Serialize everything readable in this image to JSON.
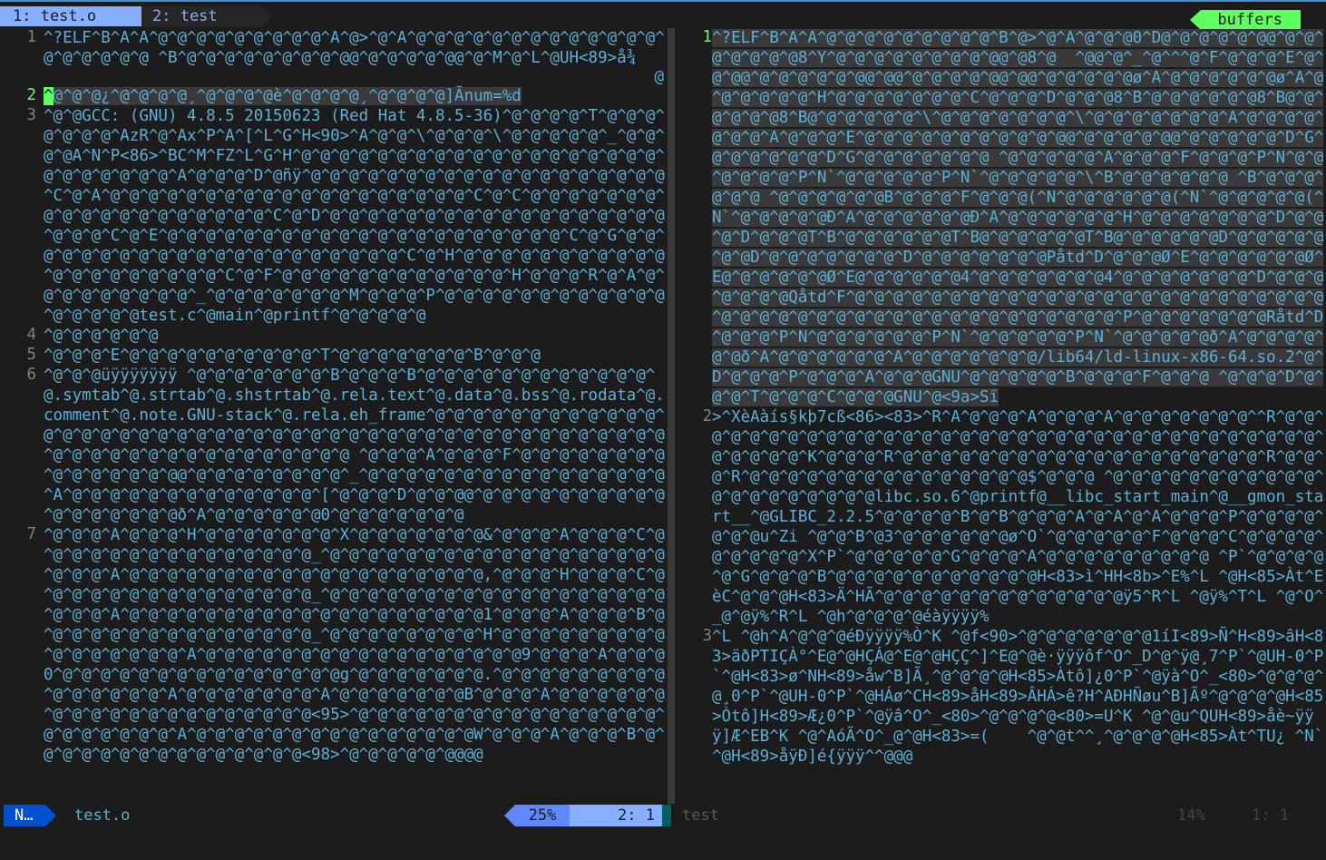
{
  "tabs": [
    {
      "label": "1: test.o"
    },
    {
      "label": "2: test"
    }
  ],
  "buffers_label": "buffers",
  "left_pane": {
    "lines": [
      {
        "num": "1",
        "text": "^?ELF^B^A^A^@^@^@^@^@^@^@^@^@^A^@>^@^A^@^@^@^@^@^@^@^@^@^@^@^@^@^@^@^@^@^@^@ ^B^@^@^@^@^@^@^@^@^@@^@^@^@^@^@@^@^M^@^L^@UH<89>å¾",
        "trail": "@"
      },
      {
        "num": "2",
        "text": "^@^@^@¿^@^@^@^@¸^@^@^@^@è^@^@^@^@¸^@^@^@^@]Ãnum=%d"
      },
      {
        "num": "3",
        "text": "^@^@GCC: (GNU) 4.8.5 20150623 (Red Hat 4.8.5-36)^@^@^@^@^T^@^@^@^@^@^@^@^AzR^@^Ax^P^A^[^L^G^H<90>^A^@^@^\\^@^@^@^\\^@^@^@^@^@^_^@^@^@^@A^N^P<86>^BC^M^FZ^L^G^H^@^@^@^@^@^@^@^@^@^@^@^@^@^@^@^@^@^@^@^@^@^@^@^@^@^@^A^@^@^@^D^@ñÿ^@^@^@^@^@^@^@^@^@^@^@^@^@^@^@^@^@^@^@^C^@^A^@^@^@^@^@^@^@^@^@^@^@^@^@^@^@^@^@^@^@^C^@^C^@^@^@^@^@^@^@^@^@^@^@^@^@^@^@^@^@^@^@^C^@^D^@^@^@^@^@^@^@^@^@^@^@^@^@^@^@^@^@^@^@^@^@^C^@^E^@^@^@^@^@^@^@^@^@^@^@^@^@^@^@^@^@^@^@^@^@^C^@^G^@^@^@^@^@^@^@^@^@^@^@^@^@^@^@^@^@^@^@^@^@^C^@^H^@^@^@^@^@^@^@^@^@^@^@^@^@^@^@^@^@^@^@^@^C^@^F^@^@^@^@^@^@^@^@^@^@^@^@^H^@^@^@^R^@^A^@^@^@^@^@^@^@^@^@^_^@^@^@^@^@^@^@^M^@^@^@^P^@^@^@^@^@^@^@^@^@^@^@^@^@^@^@^@^@test.c^@main^@printf^@^@^@^@^@"
      },
      {
        "num": "4",
        "text": "^@^@^@^@^@^@"
      },
      {
        "num": "5",
        "text": "^@^@^@^E^@^@^@^@^@^@^@^@^@^@^T^@^@^@^@^@^@^@^B^@^@^@"
      },
      {
        "num": "6",
        "text": "^@^@^@üÿÿÿÿÿÿÿ ^@^@^@^@^@^@^@^B^@^@^@^B^@^@^@^@^@^@^@^@^@^@^@^@^@.symtab^@.strtab^@.shstrtab^@.rela.text^@.data^@.bss^@.rodata^@.comment^@.note.GNU-stack^@.rela.eh_frame^@^@^@^@^@^@^@^@^@^@^@^@^@^@^@^@^@^@^@^@^@^@^@^@^@^@^@^@^@^@^@^@^@^@^@^@^@^@^@^@^@^@^@^@^@^@^@^@^@^@^@^@^@^@^@^@^@^@^@^@^@ ^@^@^@^A^@^@^@^F^@^@^@^@^@^@^@^@^@^@^@^@^@^@^@@^@^@^@^@^@^@^@^@^_^@^@^@^@^@^@^@^@^@^@^@^@^@^@^@^@^A^@^@^@^@^@^@^@^@^@^@^@^@^@^[^@^@^@^D^@^@^@@^@^@^@^@^@^@^@^@^@^@^@^@^@^@^@^@^@ð^A^@^@^@^@^@^@0^@^@^@^@^@^@^@"
      },
      {
        "num": "7",
        "text": "^@^@^@^A^@^@^@^H^@^@^@^@^@^@^@^X^@^@^@^@^@^@^@&^@^@^@^A^@^@^@^C^@^@^@^@^@^@^@^@^@^@^@^@^@^@^@_^@^@^@^@^@^@^@^@^@^@^@^@^@^@^@^@^@^@^@^@^@^A^@^@^@^@^@^@^@^@^@^@^@^@^@^@^@^@^@^@^@,^@^@^@^H^@^@^@^C^@^@^@^@^@^@^@^@^@^@^@^@^@^@^@_^@^@^@^@^@^@^@^@^@^@^@^@^@^@^@^@^@^@^@^@^@^A^@^@^@^@^@^@^@^@^@^@^@^@^@^@^@^@^@^@^@1^@^@^@^A^@^@^@^B^@^@^@^@^@^@^@^@^@^@^@^@^@^@^@_^@^@^@^@^@^@^@^@^H^@^@^@^@^@^@^@^@^@^@^@^@^@^@^@^@^A^@^@^@^@^@^@^@^@^@^@^@^@^@^@^@^@^@9^@^@^@^A^@^@^@0^@^@^@^@^@^@^@^@^@^@^@^@^@^@^@g^@^@^@^@^@^@^@.^@^@^@^@^@^@^@^@^@^@^@^@^@^@^@^A^@^@^@^@^@^@^@^A^@^@^@^@^@^@^@B^@^@^@^A^@^@^@^@^@^@^@^@^@^@^@^@^@^@^@^@^@^@^@^@<95>^@^@^@^@^@^@^@^@^@^@^@^@^@^@^@^@^@^@^@^@^@^@^@^A^@^@^@^@^@^@^@^@^@^@^@^@^@^@^@W^@^@^@^A^@^@^@^B^@^@^@^@^@^@^@^@^@^@^@^@^@^@^@<98>^@^@^@^@^@^@@@@"
      }
    ]
  },
  "right_pane": {
    "lines": [
      {
        "num": "1",
        "text": "^?ELF^B^A^A^@^@^@^@^@^@^@^@^@^B^@>^@^A^@^@^@0^D@^@^@^@^@^@@^@^@^@^@^@^@^@8^Y^@^@^@^@^@^@^@^@^@@^@8^@  ^@@^@^_^@^^^@^F^@^@^@^E^@^@^@@^@^@^@^@^@^@@^@@^@^@^@^@^@@^@@^@^@^@^@^@ø^A^@^@^@^@^@^@ø^A^@^@^@^@^@^@^H^@^@^@^@^@^@^@^C^@^@^@^D^@^@^@8^B^@^@^@^@^@^@8^B@^@^@^@^@^@8^B@^@^@^@^@^@^\\^@^@^@^@^@^@^@^\\^@^@^@^@^@^@^@^A^@^@^@^@^@^@^@^A^@^@^@^E^@^@^@^@^@^@^@^@^@^@^@@^@^@^@^@^@@^@^@^@^@^@^D^G^@^@^@^@^@^@^D^G^@^@^@^@^@^@^@ ^@^@^@^@^@^A^@^@^@^F^@^@^@^P^N^@^@^@^@^@^@^P^N`^@^@^@^@^@^P^N`^@^@^@^@^@^\\^B^@^@^@^@^@^@ ^B^@^@^@^@^@^@ ^@^@^@^@^@^@B^@^@^@^F^@^@^@(^N^@^@^@^@^@^@(^N`^@^@^@^@^@(^N`^@^@^@^@^@Ð^A^@^@^@^@^@^@Ð^A^@^@^@^@^@^@^H^@^@^@^@^@^@^@^D^@^@^@^D^@^@^@T^B^@^@^@^@^@^@T^B@^@^@^@^@^@T^B@^@^@^@^@^@D^@^@^@^@^@^@^@D^@^@^@^@^@^@^@^D^@^@^@^@^@^@^@Påtd^D^@^@^@Ø^E^@^@^@^@^@^@Ø^E@^@^@^@^@^@Ø^E@^@^@^@^@^@4^@^@^@^@^@^@^@4^@^@^@^@^@^@^@^D^@^@^@^@^@^@^@Qåtd^F^@^@^@^@^@^@^@^@^@^@^@^@^@^@^@^@^@^@^@^@^@^@^@^@^@^@^@^@^@^@^@^@^@^@^@^@^@^@^@^@^@^@^@^@^@^@^P^@^@^@^@^@^@^@Råtd^D^@^@^@^P^N^@^@^@^@^@^@^P^N`^@^@^@^@^@^P^N`^@^@^@^@^@ð^A^@^@^@^@^@^@ð^A^@^@^@^@^@^@^A^@^@^@^@^@^@^@/lib64/ld-linux-x86-64.so.2^@^D^@^@^@^P^@^@^@^A^@^@^@GNU^@^@^@^@^@^B^@^@^@^F^@^@^@ ^@^@^@^D^@^@^@^T^@^@^@^C^@^@^@GNU^@<9a>Sï"
      },
      {
        "num": "2",
        "text": ">^XèAàís§kþ7cß<86><83>^R^A^@^@^@^A^@^@^@^A^@^@^@^@^@^@^@^^R^@^@^@^@^@^@^@^@^@^@^@^@^@^@^@^@^@^@^@^@^@^@^@^@^@^@^@^@^@^@^@^@^@^@^@^@^@^@^@^K^@^@^@^R^@^@^@^@^@^@^@^@^@^@^@^@^@^@^@^@^@^@^@^R^@^@^@^R^@^@^@^@^@^@^@^@^@^@^@^@^@^@^@$^@^@^@ ^@^@^@^@^@^@^@^@^@^@^@^@^@^@^@^@^@^@^@^@libc.so.6^@printf@__libc_start_main^@__gmon_start__^@GLIBC_2.2.5^@^@^@^@^B^@^B^@^@^@^A^@^A^@^A^@^@^@^P^@^@^@^@^@^@^@u^Zi ^@^@^B^@3^@^@^@^@^@^@ø^O`^@^@^@^@^@^F^@^@^@^C^@^@^@^@^@^@^@^@^@^X^P`^@^@^@^@^@^G^@^@^@^A^@^@^@^@^@^@^@^@^@ ^P`^@^@^@^@^@^G^@^@^@^B^@^@^@^@^@^@^@^@^@^@^@H<83>ì^HH<8b>^E%^L ^@H<85>Àt^EèC^@^@^@H<83>Ä^HÃ^@^@^@^@^@^@^@^@^@^@^@^@^@ÿ5^R^L ^@ÿ%^T^L ^@^O^_@^@ÿ%^R^L ^@h^@^@^@^@éàÿÿÿÿ%"
      },
      {
        "num": "3",
        "text": "^L ^@h^A^@^@^@éÐÿÿÿÿ%Ò^K ^@f<90>^@^@^@^@^@^@^@1íI<89>Ñ^H<89>âH<83>äðPTIÇÀ°^E@^@HÇÁ@^E@^@HÇÇ^]^E@^@è·ÿÿÿôf^O^_D^@^ÿ@¸7^P`^@UH-0^P`^@H<83>ø^NH<89>åw^B]Ã¸^@^@^@^@H<85>Àtô]¿0^P`^@ÿà^O^_<80>^@^@^@^@¸0^P`^@UH-0^P`^@HÁø^CH<89>åH<89>ÂHÁ>ê?H^AÐHÑøu^B]Ãº^@^@^@^@H<85>Òtô]H<89>Æ¿0^P`^@ÿâ^O^_<80>^@^@^@^@<80>=U^K ^@^@u^QUH<89>åè~ÿÿÿ]Æ^EB^K ^@^AóÃ^O^_@^@H<83>=(    ^@^@t^^¸^@^@^@^@H<85>Àt^TU¿ ^N`^@H<89>åÿÐ]é{ÿÿÿ^^@@@"
      }
    ]
  },
  "status": {
    "mode": "N…",
    "left_filename": "test.o",
    "left_percent": "25%",
    "left_position": "2:  1",
    "right_filename": "test",
    "right_percent": "14%",
    "right_position": "1:  1"
  }
}
